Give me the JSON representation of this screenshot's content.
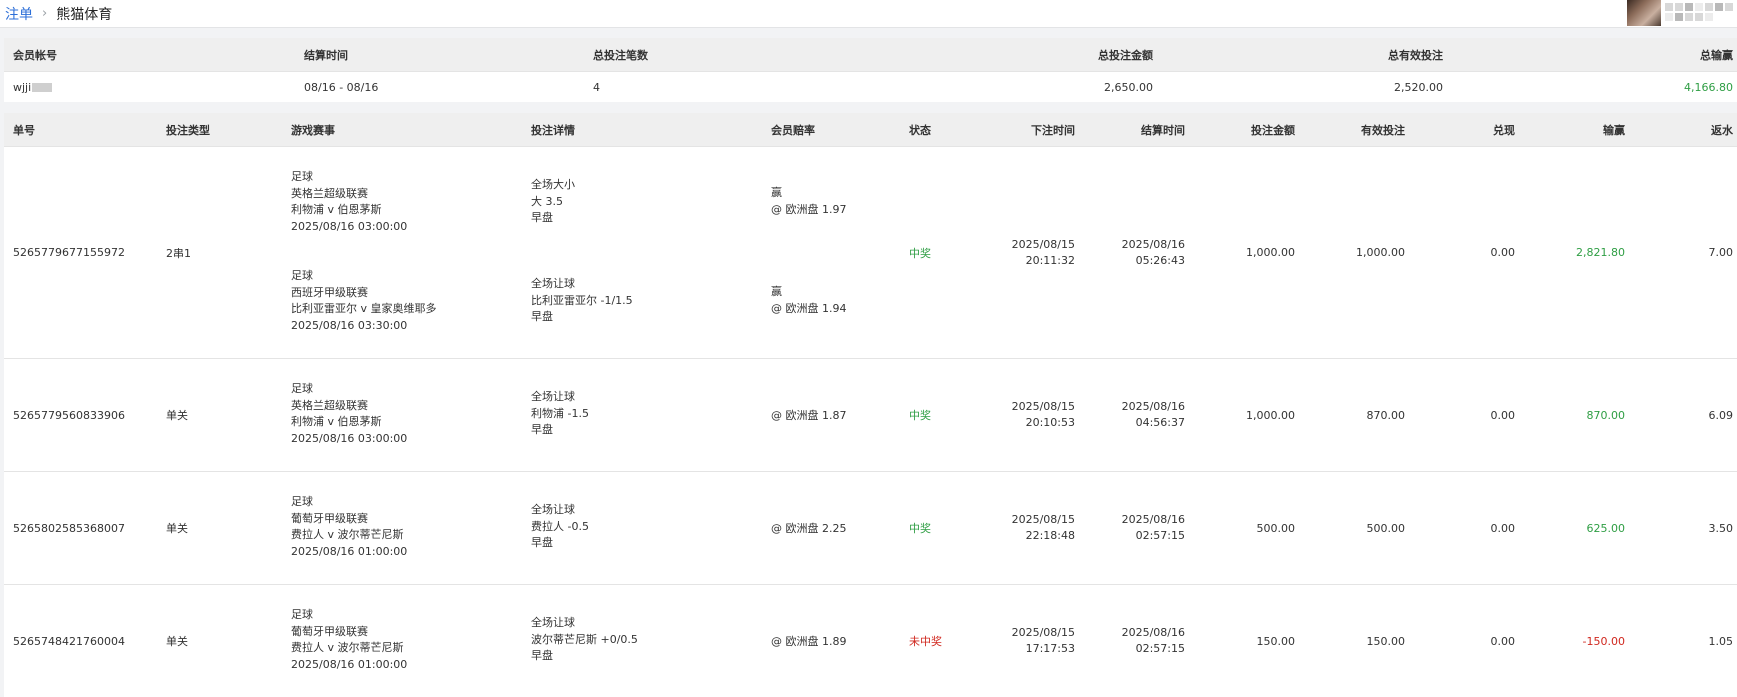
{
  "breadcrumb": {
    "parent": "注单",
    "separator": "›",
    "current": "熊猫体育"
  },
  "summary": {
    "headers": {
      "account": "会员帐号",
      "settle_time": "结算时间",
      "count": "总投注笔数",
      "total_amount": "总投注金额",
      "total_valid": "总有效投注",
      "total_winloss": "总输赢"
    },
    "row": {
      "account": "wjji",
      "settle_time": "08/16 - 08/16",
      "count": "4",
      "total_amount": "2,650.00",
      "total_valid": "2,520.00",
      "total_winloss": "4,166.80"
    }
  },
  "table": {
    "headers": {
      "order_no": "单号",
      "bet_type": "投注类型",
      "event": "游戏赛事",
      "detail": "投注详情",
      "odds": "会员赔率",
      "status": "状态",
      "bet_time": "下注时间",
      "settle_time": "结算时间",
      "amount": "投注金额",
      "valid": "有效投注",
      "cashout": "兑现",
      "winloss": "输赢",
      "rebate": "返水"
    },
    "rows": [
      {
        "order_no": "5265779677155972",
        "bet_type": "2串1",
        "legs": [
          {
            "sport": "足球",
            "league": "英格兰超级联赛",
            "match": "利物浦 v 伯恩茅斯",
            "time": "2025/08/16 03:00:00",
            "market": "全场大小",
            "pick": "大 3.5",
            "period": "早盘",
            "result": "赢",
            "odds": "@ 欧洲盘 1.97"
          },
          {
            "sport": "足球",
            "league": "西班牙甲级联赛",
            "match": "比利亚雷亚尔 v 皇家奥维耶多",
            "time": "2025/08/16 03:30:00",
            "market": "全场让球",
            "pick": "比利亚雷亚尔 -1/1.5",
            "period": "早盘",
            "result": "赢",
            "odds": "@ 欧洲盘 1.94"
          }
        ],
        "status": "中奖",
        "bet_date": "2025/08/15",
        "bet_clock": "20:11:32",
        "settle_date": "2025/08/16",
        "settle_clock": "05:26:43",
        "amount": "1,000.00",
        "valid": "1,000.00",
        "cashout": "0.00",
        "winloss": "2,821.80",
        "rebate": "7.00"
      },
      {
        "order_no": "5265779560833906",
        "bet_type": "单关",
        "legs": [
          {
            "sport": "足球",
            "league": "英格兰超级联赛",
            "match": "利物浦 v 伯恩茅斯",
            "time": "2025/08/16 03:00:00",
            "market": "全场让球",
            "pick": "利物浦 -1.5",
            "period": "早盘",
            "result": "",
            "odds": "@ 欧洲盘 1.87"
          }
        ],
        "status": "中奖",
        "bet_date": "2025/08/15",
        "bet_clock": "20:10:53",
        "settle_date": "2025/08/16",
        "settle_clock": "04:56:37",
        "amount": "1,000.00",
        "valid": "870.00",
        "cashout": "0.00",
        "winloss": "870.00",
        "rebate": "6.09"
      },
      {
        "order_no": "5265802585368007",
        "bet_type": "单关",
        "legs": [
          {
            "sport": "足球",
            "league": "葡萄牙甲级联赛",
            "match": "费拉人 v 波尔蒂芒尼斯",
            "time": "2025/08/16 01:00:00",
            "market": "全场让球",
            "pick": "费拉人 -0.5",
            "period": "早盘",
            "result": "",
            "odds": "@ 欧洲盘 2.25"
          }
        ],
        "status": "中奖",
        "bet_date": "2025/08/15",
        "bet_clock": "22:18:48",
        "settle_date": "2025/08/16",
        "settle_clock": "02:57:15",
        "amount": "500.00",
        "valid": "500.00",
        "cashout": "0.00",
        "winloss": "625.00",
        "rebate": "3.50"
      },
      {
        "order_no": "5265748421760004",
        "bet_type": "单关",
        "legs": [
          {
            "sport": "足球",
            "league": "葡萄牙甲级联赛",
            "match": "费拉人 v 波尔蒂芒尼斯",
            "time": "2025/08/16 01:00:00",
            "market": "全场让球",
            "pick": "波尔蒂芒尼斯 +0/0.5",
            "period": "早盘",
            "result": "",
            "odds": "@ 欧洲盘 1.89"
          }
        ],
        "status": "未中奖",
        "bet_date": "2025/08/15",
        "bet_clock": "17:17:53",
        "settle_date": "2025/08/16",
        "settle_clock": "02:57:15",
        "amount": "150.00",
        "valid": "150.00",
        "cashout": "0.00",
        "winloss": "-150.00",
        "rebate": "1.05"
      }
    ]
  },
  "colors": {
    "win": "#2f9e44",
    "loss": "#d0281f",
    "link": "#2d6fd8",
    "header_bg": "#efefef"
  }
}
